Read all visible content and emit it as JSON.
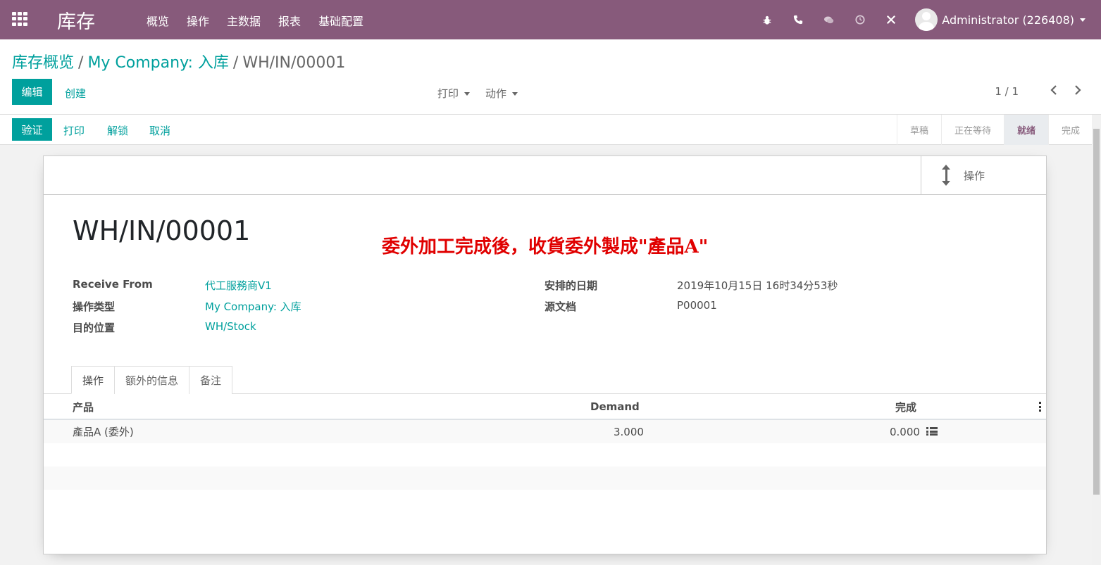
{
  "navbar": {
    "brand": "库存",
    "menu": [
      "概览",
      "操作",
      "主数据",
      "报表",
      "基础配置"
    ],
    "systray_icons": [
      "bug-icon",
      "phone-icon",
      "chat-icon",
      "clock-icon",
      "tools-icon"
    ],
    "user": "Administrator (226408)"
  },
  "breadcrumb": {
    "items": [
      "库存概览",
      "My Company: 入库"
    ],
    "current": "WH/IN/00001"
  },
  "control": {
    "edit": "编辑",
    "create": "创建",
    "print": "打印",
    "action": "动作",
    "pager": "1 / 1"
  },
  "statusbar": {
    "buttons": [
      "验证",
      "打印",
      "解锁",
      "取消"
    ],
    "stages": [
      "草稿",
      "正在等待",
      "就绪",
      "完成"
    ],
    "active_stage": "就绪"
  },
  "sheet": {
    "smart_button": "操作",
    "title": "WH/IN/00001",
    "annotation": "委外加工完成後，收貨委外製成\"產品A\"",
    "fields_left": [
      {
        "label": "Receive From",
        "value": "代工服務商V1"
      },
      {
        "label": "操作类型",
        "value": "My Company: 入库"
      },
      {
        "label": "目的位置",
        "value": "WH/Stock"
      }
    ],
    "fields_right": [
      {
        "label": "安排的日期",
        "value": "2019年10月15日 16时34分53秒"
      },
      {
        "label": "源文档",
        "value": "P00001"
      }
    ],
    "tabs": [
      "操作",
      "额外的信息",
      "备注"
    ],
    "table": {
      "headers": [
        "产品",
        "Demand",
        "完成"
      ],
      "rows": [
        {
          "product": "產品A (委外)",
          "demand": "3.000",
          "done": "0.000"
        }
      ]
    }
  },
  "colors": {
    "navbar": "#875a7b",
    "primary": "#00a09d",
    "annotation": "#e00000"
  }
}
